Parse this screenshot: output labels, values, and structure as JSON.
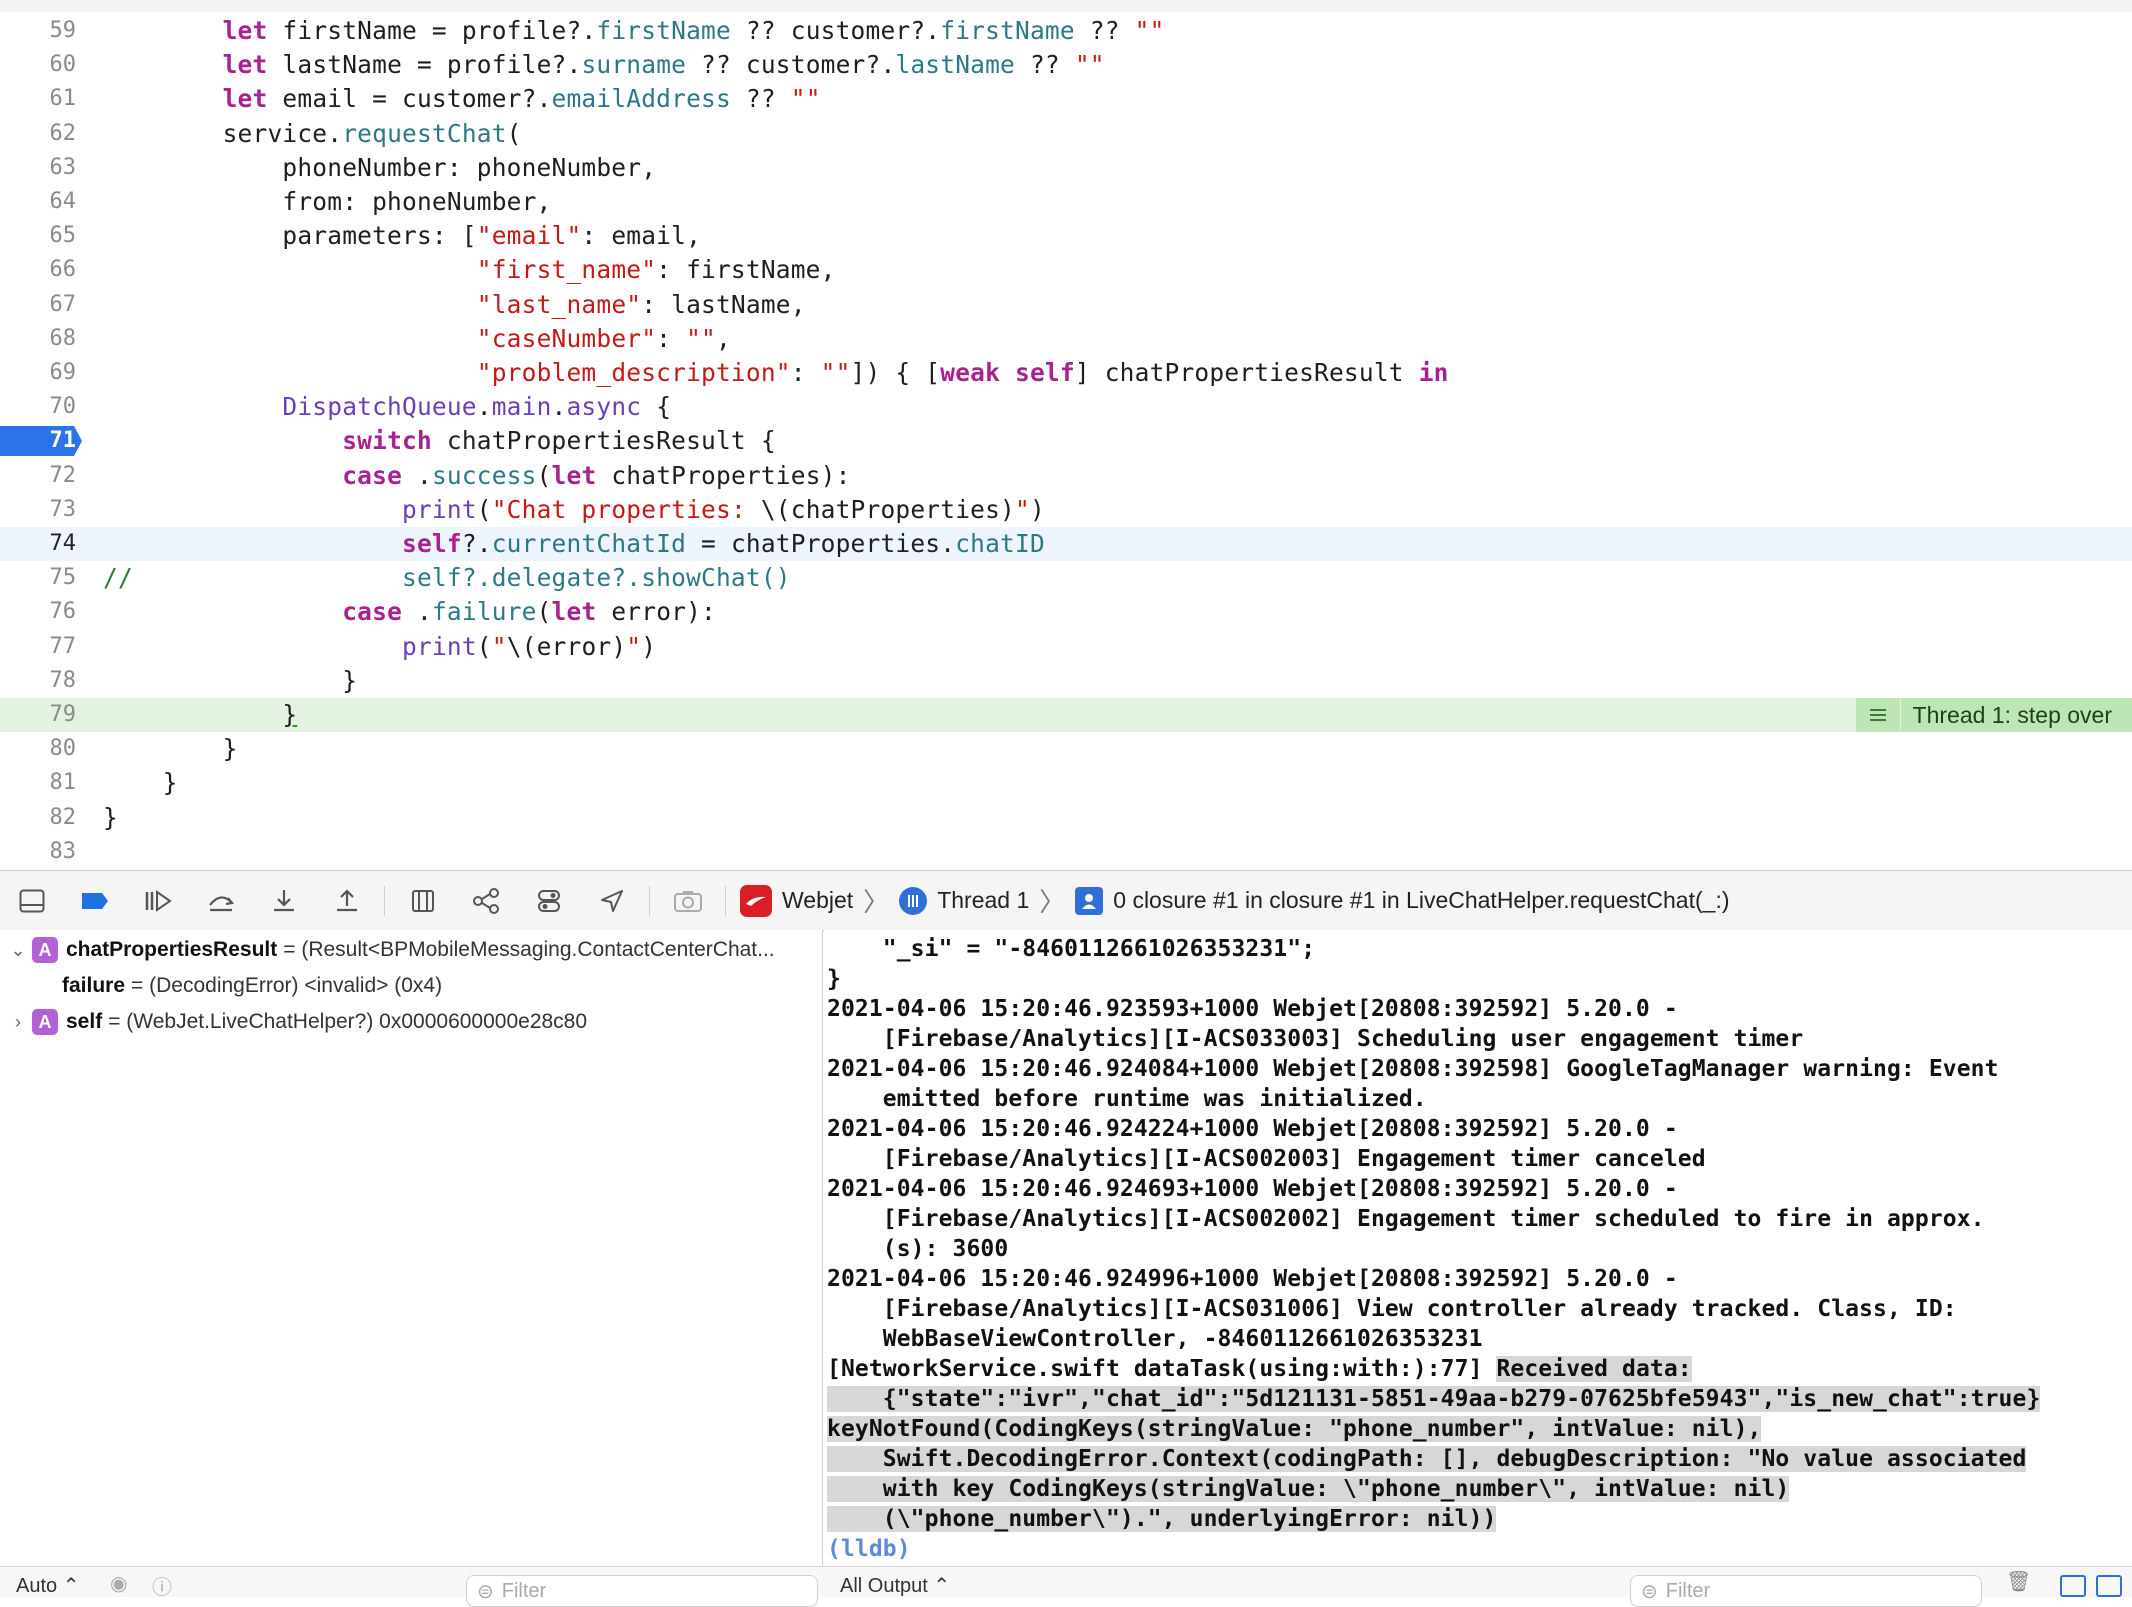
{
  "editor": {
    "lines": [
      {
        "n": "59",
        "html": "        <span class='kw'>let</span> firstName = profile?.<span class='mem'>firstName</span> ?? customer?.<span class='mem'>firstName</span> ?? <span class='str'>\"\"</span>"
      },
      {
        "n": "60",
        "html": "        <span class='kw'>let</span> lastName = profile?.<span class='mem'>surname</span> ?? customer?.<span class='mem'>lastName</span> ?? <span class='str'>\"\"</span>"
      },
      {
        "n": "61",
        "html": "        <span class='kw'>let</span> email = customer?.<span class='mem'>emailAddress</span> ?? <span class='str'>\"\"</span>"
      },
      {
        "n": "62",
        "html": "        service.<span class='mem'>requestChat</span>("
      },
      {
        "n": "63",
        "html": "            phoneNumber: phoneNumber,"
      },
      {
        "n": "64",
        "html": "            from: phoneNumber,"
      },
      {
        "n": "65",
        "html": "            parameters: [<span class='str'>\"email\"</span>: email,"
      },
      {
        "n": "66",
        "html": "                         <span class='str'>\"first_name\"</span>: firstName,"
      },
      {
        "n": "67",
        "html": "                         <span class='str'>\"last_name\"</span>: lastName,"
      },
      {
        "n": "68",
        "html": "                         <span class='str'>\"caseNumber\"</span>: <span class='str'>\"\"</span>,"
      },
      {
        "n": "69",
        "html": "                         <span class='str'>\"problem_description\"</span>: <span class='str'>\"\"</span>]) { [<span class='kw'>weak</span> <span class='kw'>self</span>] chatPropertiesResult <span class='kw'>in</span>"
      },
      {
        "n": "70",
        "html": "            <span class='typ'>DispatchQueue</span>.<span class='typ'>main</span>.<span class='typ'>async</span> {"
      },
      {
        "n": "71",
        "html": "                <span class='kw'>switch</span> chatPropertiesResult {",
        "breakpoint": true
      },
      {
        "n": "72",
        "html": "                <span class='kw'>case</span> .<span class='mem'>success</span>(<span class='kw'>let</span> chatProperties):"
      },
      {
        "n": "73",
        "html": "                    <span class='typ'>print</span>(<span class='str'>\"Chat properties: </span>\\(chatProperties)<span class='str'>\"</span>)"
      },
      {
        "n": "74",
        "html": "                    <span class='kw'>self</span>?.<span class='mem'>currentChatId</span> = chatProperties.<span class='mem'>chatID</span>",
        "current": true
      },
      {
        "n": "75",
        "html": "<span class='cmt'>//</span>                  <span class='mem'>self?.delegate?.showChat()</span>"
      },
      {
        "n": "76",
        "html": "                <span class='kw'>case</span> .<span class='mem'>failure</span>(<span class='kw'>let</span> error):"
      },
      {
        "n": "77",
        "html": "                    <span class='typ'>print</span>(<span class='str'>\"</span>\\(error)<span class='str'>\"</span>)"
      },
      {
        "n": "78",
        "html": "                }"
      },
      {
        "n": "79",
        "html": "            <span style='text-decoration:underline;text-decoration-color:#2a9a2a;'>}</span>",
        "exec": true
      },
      {
        "n": "80",
        "html": "        }"
      },
      {
        "n": "81",
        "html": "    }"
      },
      {
        "n": "82",
        "html": "}"
      },
      {
        "n": "83",
        "html": ""
      }
    ],
    "thread_badge": "Thread 1: step over"
  },
  "debugbar": {
    "app": "Webjet",
    "thread": "Thread 1",
    "frame": "0 closure #1 in closure #1 in LiveChatHelper.requestChat(_:)"
  },
  "variables": [
    {
      "expanded": true,
      "badge": "A",
      "name": "chatPropertiesResult",
      "value": "= (Result<BPMobileMessaging.ContactCenterChat...",
      "indent": 0
    },
    {
      "badge": "",
      "name": "failure",
      "value": "= (DecodingError) <invalid> (0x4)",
      "indent": 1
    },
    {
      "expanded": false,
      "badge": "A",
      "name": "self",
      "value": "= (WebJet.LiveChatHelper?) 0x0000600000e28c80",
      "indent": 0
    }
  ],
  "console": {
    "lines": [
      {
        "t": "    \"_si\" = \"-8460112661026353231\";"
      },
      {
        "t": "}"
      },
      {
        "t": "2021-04-06 15:20:46.923593+1000 Webjet[20808:392592] 5.20.0 -"
      },
      {
        "t": "    [Firebase/Analytics][I-ACS033003] Scheduling user engagement timer"
      },
      {
        "t": "2021-04-06 15:20:46.924084+1000 Webjet[20808:392598] GoogleTagManager warning: Event"
      },
      {
        "t": "    emitted before runtime was initialized."
      },
      {
        "t": "2021-04-06 15:20:46.924224+1000 Webjet[20808:392592] 5.20.0 -"
      },
      {
        "t": "    [Firebase/Analytics][I-ACS002003] Engagement timer canceled"
      },
      {
        "t": "2021-04-06 15:20:46.924693+1000 Webjet[20808:392592] 5.20.0 -"
      },
      {
        "t": "    [Firebase/Analytics][I-ACS002002] Engagement timer scheduled to fire in approx."
      },
      {
        "t": "    (s): 3600"
      },
      {
        "t": "2021-04-06 15:20:46.924996+1000 Webjet[20808:392592] 5.20.0 -"
      },
      {
        "t": "    [Firebase/Analytics][I-ACS031006] View controller already tracked. Class, ID:"
      },
      {
        "t": "    WebBaseViewController, -8460112661026353231"
      },
      {
        "pre": "[NetworkService.swift dataTask(using:with:):77] ",
        "t": "Received data:",
        "hl": true
      },
      {
        "t": "    {\"state\":\"ivr\",\"chat_id\":\"5d121131-5851-49aa-b279-07625bfe5943\",\"is_new_chat\":true}",
        "hl": true
      },
      {
        "t": "keyNotFound(CodingKeys(stringValue: \"phone_number\", intValue: nil),",
        "hl": true
      },
      {
        "t": "    Swift.DecodingError.Context(codingPath: [], debugDescription: \"No value associated",
        "hl": true
      },
      {
        "t": "    with key CodingKeys(stringValue: \\\"phone_number\\\", intValue: nil)",
        "hl": true
      },
      {
        "t": "    (\\\"phone_number\\\").\", underlyingError: nil))",
        "hl": true
      },
      {
        "t": "(lldb)",
        "lldb": true
      }
    ]
  },
  "bottombar": {
    "auto": "Auto ⌃",
    "filter_left": "Filter",
    "output": "All Output ⌃",
    "filter_right": "Filter"
  }
}
